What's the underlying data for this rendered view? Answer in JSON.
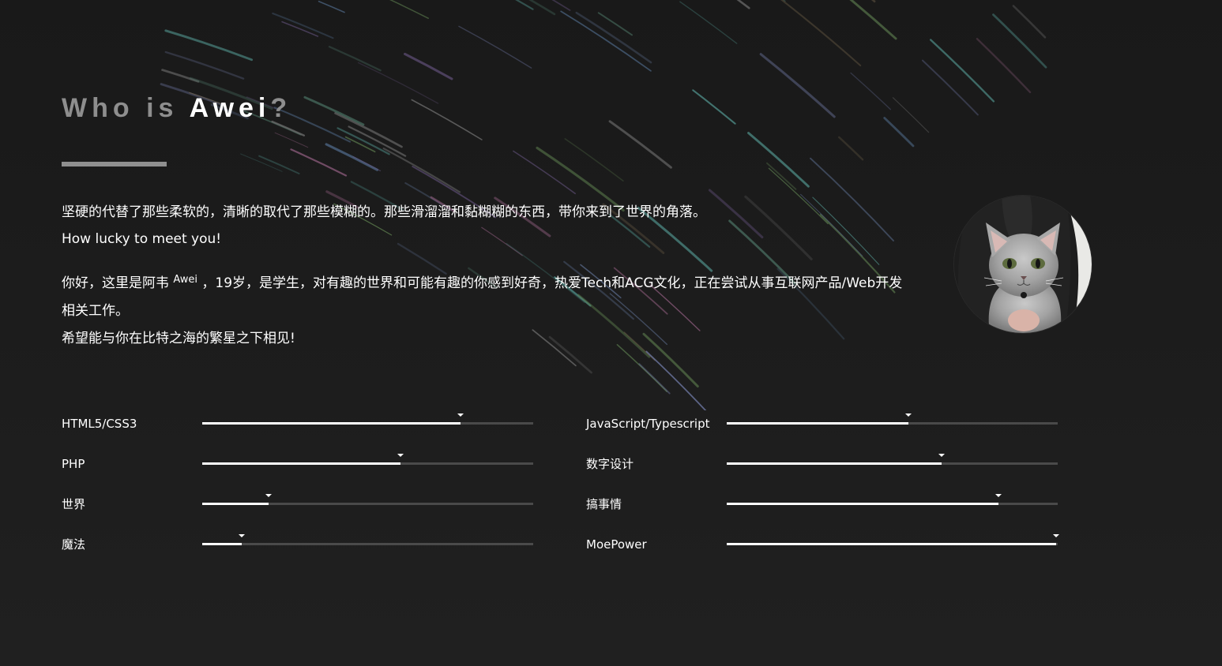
{
  "page": {
    "background_color": "#1f1f1f",
    "accent_color": "#ffffff"
  },
  "header": {
    "title_part1": "Who is ",
    "title_name": "Awei",
    "title_mark": "?"
  },
  "intro": {
    "line1": "坚硬的代替了那些柔软的，清晰的取代了那些模糊的。那些滑溜溜和黏糊糊的东西，带你来到了世界的角落。",
    "line2": "How lucky to meet you!"
  },
  "about": {
    "text_before": "你好，这里是阿韦 ",
    "nickname": "Awei",
    "text_after": " ，19岁，是学生，对有趣的世界和可能有趣的你感到好奇，热爱Tech和ACG文化，正在尝试从事互联网产品/Web开发相关工作。",
    "closing": "希望能与你在比特之海的繁星之下相见!"
  },
  "avatar": {
    "icon": "cat-avatar-icon"
  },
  "skills": [
    {
      "label": "HTML5/CSS3",
      "level": 0.78
    },
    {
      "label": "JavaScript/Typescript",
      "level": 0.55
    },
    {
      "label": "PHP",
      "level": 0.6
    },
    {
      "label": "数字设计",
      "level": 0.65
    },
    {
      "label": "世界",
      "level": 0.2
    },
    {
      "label": "搞事情",
      "level": 0.82
    },
    {
      "label": "魔法",
      "level": 0.12
    },
    {
      "label": "MoePower",
      "level": 0.995
    }
  ]
}
